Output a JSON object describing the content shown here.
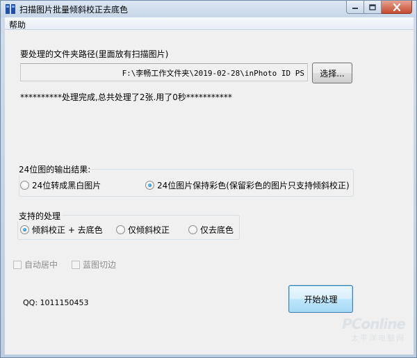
{
  "window": {
    "title": "扫描图片批量倾斜校正去底色",
    "icon": "app-icon",
    "controls": [
      "minimize-icon",
      "maximize-icon",
      "close-icon"
    ]
  },
  "menu": {
    "items": [
      "帮助"
    ]
  },
  "folder": {
    "label": "要处理的文件夹路径(里面放有扫描图片)",
    "path": "F:\\李畅工作文件夹\\2019-02-28\\inPhoto ID PS",
    "browse_label": "选择..."
  },
  "status": "**********处理完成,总共处理了2张.用了0秒***********",
  "output_group": {
    "title": "24位图的输出结果:",
    "options": [
      "24位转成黑白图片",
      "24位图片保持彩色(保留彩色的图片只支持倾斜校正)"
    ],
    "selected": 1
  },
  "process_group": {
    "title": "支持的处理",
    "options": [
      "倾斜校正 + 去底色",
      "仅倾斜校正",
      "仅去底色"
    ],
    "selected": 0
  },
  "checks": {
    "auto_center": "自动居中",
    "crop": "蓝图切边"
  },
  "qq": "QQ: 1011150453",
  "start_label": "开始处理",
  "watermark": {
    "brand": "PConline",
    "cn": "太平洋电脑网"
  }
}
